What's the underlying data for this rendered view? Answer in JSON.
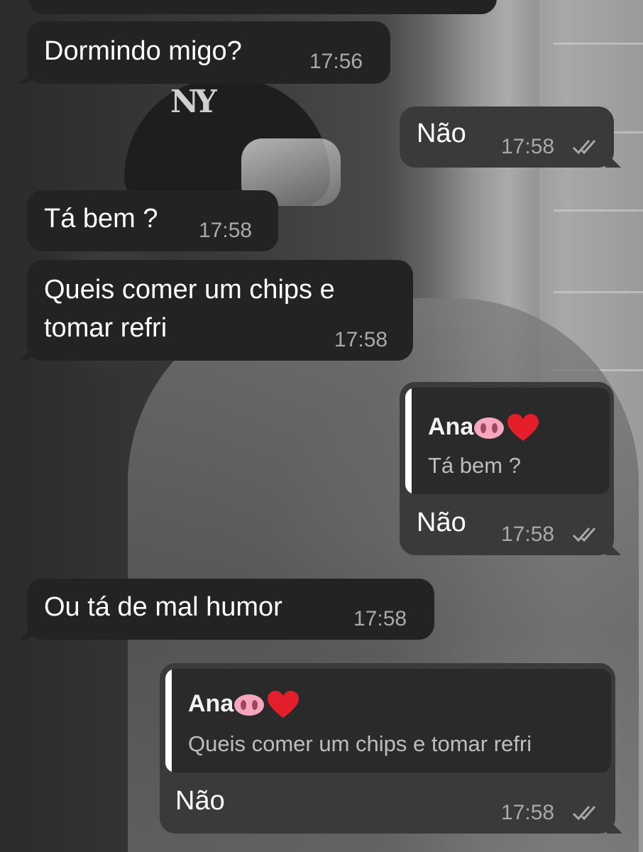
{
  "messages": [
    {
      "direction": "in",
      "text": "Dormindo migo?",
      "time": "17:56"
    },
    {
      "direction": "out",
      "text": "Não",
      "time": "17:58",
      "status": "read"
    },
    {
      "direction": "in",
      "text": "Tá bem ?",
      "time": "17:58"
    },
    {
      "direction": "in",
      "text_lines": [
        "Queis comer um chips e",
        "tomar refri"
      ],
      "time": "17:58"
    },
    {
      "direction": "out",
      "quote": {
        "author": "Ana",
        "text": "Tá bem ?"
      },
      "text": "Não",
      "time": "17:58",
      "status": "read"
    },
    {
      "direction": "in",
      "text": "Ou tá de mal humor",
      "time": "17:58"
    },
    {
      "direction": "out",
      "quote": {
        "author": "Ana",
        "text": "Queis comer um chips e tomar refri"
      },
      "text": "Não",
      "time": "17:58",
      "status": "read"
    }
  ],
  "icons": {
    "read_receipt": "double-check-icon",
    "author_emojis": [
      "pig-nose-emoji",
      "red-heart-emoji"
    ]
  },
  "colors": {
    "incoming_bubble": "#232323",
    "outgoing_bubble": "#3a3a3a",
    "timestamp": "#a9a9a9"
  }
}
